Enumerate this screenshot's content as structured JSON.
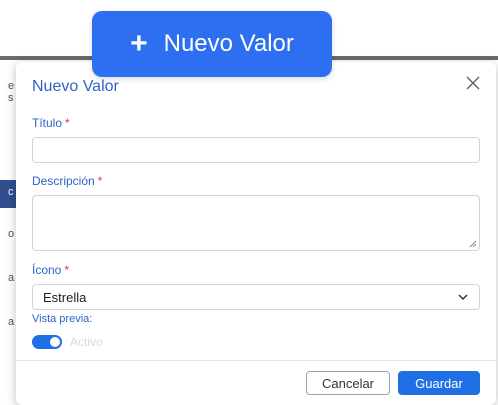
{
  "new_button": {
    "icon": "plus-icon",
    "label": "Nuevo Valor"
  },
  "background": {
    "letters": [
      "e",
      "s",
      "c",
      "o",
      "a",
      "a"
    ]
  },
  "modal": {
    "title": "Nuevo Valor",
    "close_icon": "close-icon",
    "fields": {
      "titulo": {
        "label": "Título",
        "required_mark": "*",
        "value": ""
      },
      "descripcion": {
        "label": "Descripción",
        "required_mark": "*",
        "value": ""
      },
      "icono": {
        "label": "Ícono",
        "required_mark": "*",
        "selected": "Estrella"
      }
    },
    "preview": {
      "label": "Vista previa:",
      "toggle_label": "Activo",
      "toggle_on": true
    },
    "buttons": {
      "cancel": "Cancelar",
      "save": "Guardar"
    }
  },
  "colors": {
    "accent": "#1f6fe5",
    "label": "#2e63c8",
    "required": "#e53935"
  }
}
